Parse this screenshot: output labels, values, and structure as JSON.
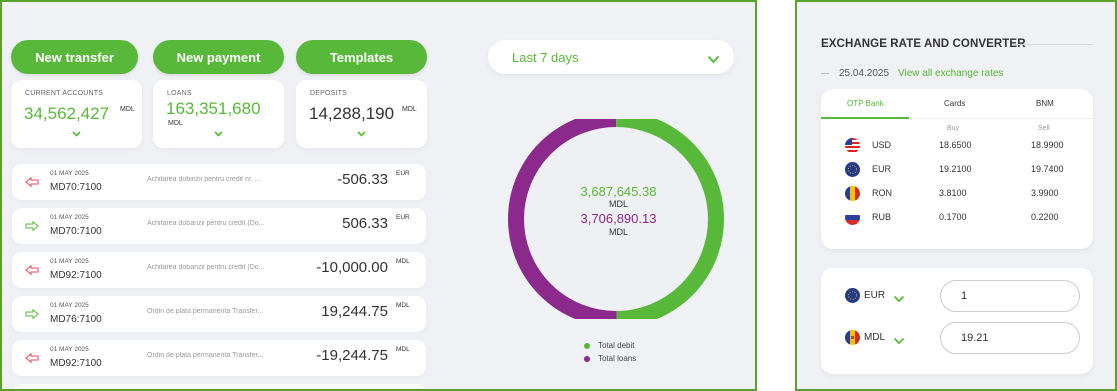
{
  "actions": {
    "new_transfer": "New transfer",
    "new_payment": "New payment",
    "templates": "Templates"
  },
  "accounts": {
    "current": {
      "title": "CURRENT ACCOUNTS",
      "value": "34,562,427",
      "currency": "MDL"
    },
    "loans": {
      "title": "LOANS",
      "value": "163,351,680",
      "currency": "MDL"
    },
    "deposits": {
      "title": "DEPOSITS",
      "value": "14,288,190",
      "currency": "MDL"
    }
  },
  "transactions": [
    {
      "direction": "out",
      "date": "01 MAY 2025",
      "account": "MD70:7100",
      "description": "Achitarea dobinzii pentru credit nr. ...",
      "amount": "-506.33",
      "currency": "EUR"
    },
    {
      "direction": "in",
      "date": "01 MAY 2025",
      "account": "MD70:7100",
      "description": "Achitarea dobanzii pentru credit (Do...",
      "amount": "506.33",
      "currency": "EUR"
    },
    {
      "direction": "out",
      "date": "01 MAY 2025",
      "account": "MD92:7100",
      "description": "Achitarea dobanzii pentru credit (Do...",
      "amount": "-10,000.00",
      "currency": "MDL"
    },
    {
      "direction": "in",
      "date": "01 MAY 2025",
      "account": "MD76:7100",
      "description": "Ordin de plata permanenta Transfer...",
      "amount": "19,244.75",
      "currency": "MDL"
    },
    {
      "direction": "out",
      "date": "01 MAY 2025",
      "account": "MD92:7100",
      "description": "Ordin de plata permanenta Transfer...",
      "amount": "-19,244.75",
      "currency": "MDL"
    }
  ],
  "period": {
    "selected": "Last 7 days"
  },
  "summary": {
    "total_debit": "3,687,645.38",
    "total_debit_currency": "MDL",
    "total_loans": "3,706,890.13",
    "total_loans_currency": "MDL",
    "debit_share": 0.4987,
    "loans_share": 0.5013,
    "legend_debit": "Total debit",
    "legend_loans": "Total loans"
  },
  "colors": {
    "green": "#58b83a",
    "purple": "#8b2a8c",
    "panel_border": "#5aa02c",
    "in_arrow": "#58b83a",
    "out_arrow": "#e04a5a"
  },
  "exchange": {
    "title": "EXCHANGE RATE AND CONVERTER",
    "date": "25.04.2025",
    "link": "View all exchange rates",
    "tabs": [
      "OTP Bank",
      "Cards",
      "BNM"
    ],
    "active_tab": "OTP Bank",
    "headers": {
      "buy": "Buy",
      "sell": "Sell"
    },
    "rates": [
      {
        "code": "USD",
        "flag": "us-flag-icon",
        "buy": "18.6500",
        "sell": "18.9900"
      },
      {
        "code": "EUR",
        "flag": "eu-flag-icon",
        "buy": "19.2100",
        "sell": "19.7400"
      },
      {
        "code": "RON",
        "flag": "ro-flag-icon",
        "buy": "3.8100",
        "sell": "3.9900"
      },
      {
        "code": "RUB",
        "flag": "ru-flag-icon",
        "buy": "0.1700",
        "sell": "0.2200"
      }
    ]
  },
  "converter": {
    "from": {
      "code": "EUR",
      "flag": "eu-flag-icon",
      "value": "1"
    },
    "to": {
      "code": "MDL",
      "flag": "md-flag-icon",
      "value": "19.21"
    }
  }
}
